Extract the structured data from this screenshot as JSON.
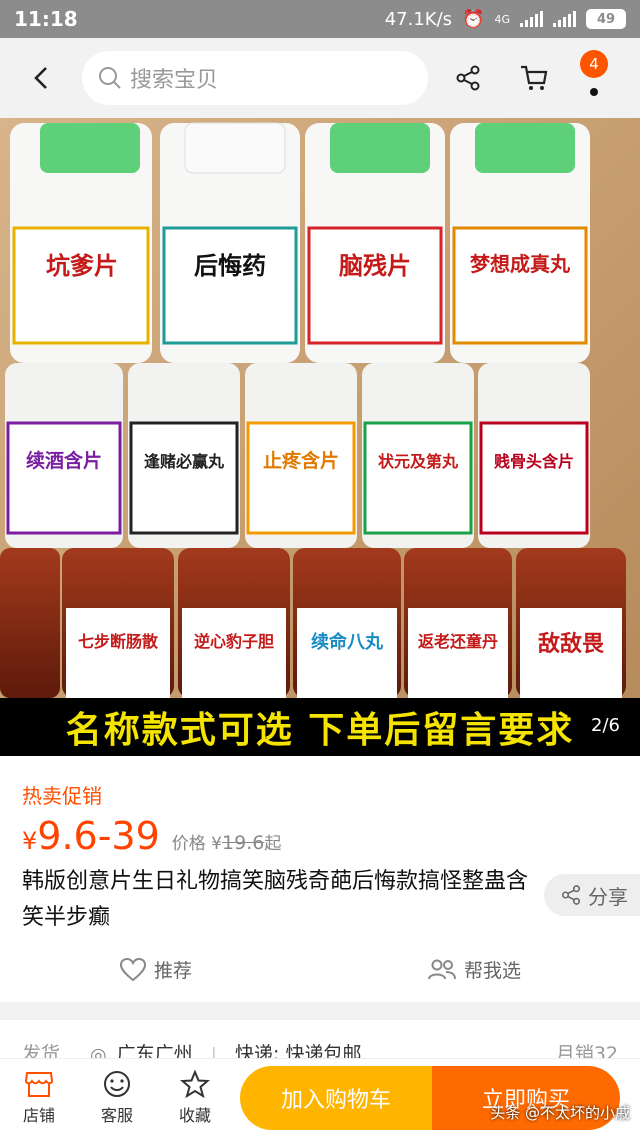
{
  "status": {
    "time": "11:18",
    "net_speed": "47.1K/s",
    "network": "4G",
    "battery": "49"
  },
  "header": {
    "search_placeholder": "搜索宝贝",
    "cart_badge": "4"
  },
  "gallery": {
    "banner_text": "名称款式可选  下单后留言要求",
    "pager": "2/6",
    "labels_top": [
      "坑爹片",
      "后悔药",
      "脑残片",
      "梦想成真丸"
    ],
    "labels_mid": [
      "续酒含片",
      "逢赌必赢丸",
      "止疼含片",
      "状元及第丸",
      "贱骨头含片"
    ],
    "labels_bot": [
      "七步断肠散",
      "逆心豹子胆",
      "续命八丸",
      "返老还童丹",
      "敌敌畏"
    ]
  },
  "product": {
    "promo_tag": "热卖促销",
    "currency": "¥",
    "price": "9.6-39",
    "orig_label": "价格 ¥",
    "orig_price": "19.6",
    "orig_suffix": "起",
    "title": "韩版创意片生日礼物搞笑脑残奇葩后悔款搞怪整蛊含笑半步癫",
    "share_label": "分享",
    "recommend_label": "推荐",
    "help_choose_label": "帮我选"
  },
  "shipping": {
    "label": "发货",
    "location": "广东广州",
    "express": "快递: 快递包邮",
    "sold": "月销32"
  },
  "bottom": {
    "store": "店铺",
    "service": "客服",
    "favorite": "收藏",
    "add_cart": "加入购物车",
    "buy_now": "立即购买"
  },
  "watermark": "头条 @不太坏的小戚",
  "colors": {
    "accent": "#ff5000",
    "cart_button": "#ffb400",
    "buy_button": "#ff6a00",
    "banner_text": "#f5e400"
  }
}
